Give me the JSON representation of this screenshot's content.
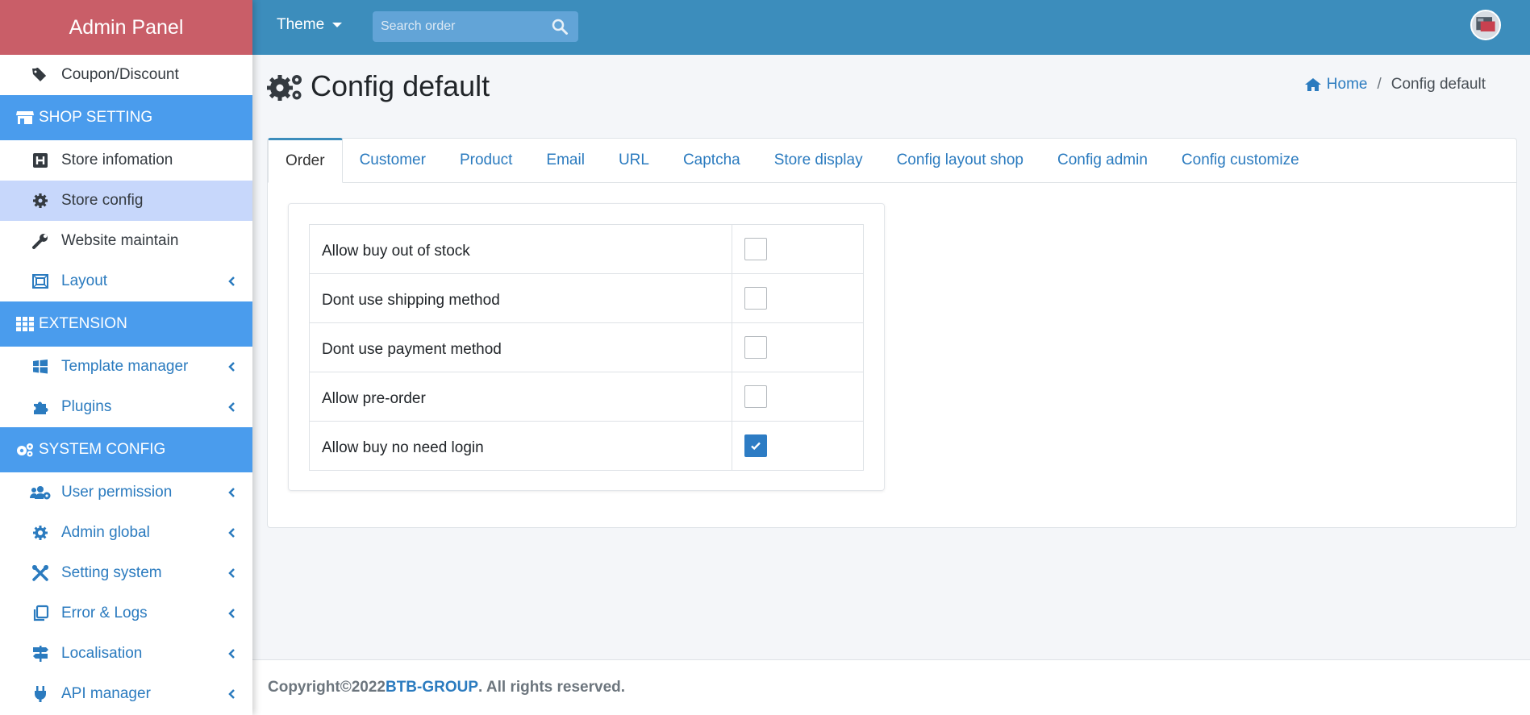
{
  "sidebar": {
    "brand": "Admin Panel",
    "items_top": [
      {
        "label": "Coupon/Discount",
        "icon": "tags-icon"
      }
    ],
    "shop_header": "SHOP SETTING",
    "shop_items": [
      {
        "label": "Store infomation",
        "icon": "h-square-icon"
      },
      {
        "label": "Store config",
        "icon": "gear-icon"
      },
      {
        "label": "Website maintain",
        "icon": "wrench-icon"
      },
      {
        "label": "Layout",
        "icon": "layout-icon"
      }
    ],
    "extension_header": "EXTENSION",
    "extension_items": [
      {
        "label": "Template manager",
        "icon": "windows-icon"
      },
      {
        "label": "Plugins",
        "icon": "puzzle-icon"
      }
    ],
    "system_header": "SYSTEM CONFIG",
    "system_items": [
      {
        "label": "User permission",
        "icon": "users-cog-icon"
      },
      {
        "label": "Admin global",
        "icon": "cog-badge-icon"
      },
      {
        "label": "Setting system",
        "icon": "tools-icon"
      },
      {
        "label": "Error & Logs",
        "icon": "copy-icon"
      },
      {
        "label": "Localisation",
        "icon": "signs-icon"
      },
      {
        "label": "API manager",
        "icon": "plug-icon"
      }
    ]
  },
  "topbar": {
    "theme_label": "Theme",
    "search_placeholder": "Search order"
  },
  "page": {
    "title": "Config default",
    "breadcrumb_home": "Home",
    "breadcrumb_current": "Config default"
  },
  "tabs": [
    "Order",
    "Customer",
    "Product",
    "Email",
    "URL",
    "Captcha",
    "Store display",
    "Config layout shop",
    "Config admin",
    "Config customize"
  ],
  "options": [
    {
      "label": "Allow buy out of stock",
      "checked": false
    },
    {
      "label": "Dont use shipping method",
      "checked": false
    },
    {
      "label": "Dont use payment method",
      "checked": false
    },
    {
      "label": "Allow pre-order",
      "checked": false
    },
    {
      "label": "Allow buy no need login",
      "checked": true
    }
  ],
  "footer": {
    "prefix": "Copyright©2022 ",
    "brand": "BTB-GROUP",
    "suffix": ". All rights reserved."
  },
  "colors": {
    "brand_bg": "#c95e68",
    "topbar_bg": "#3c8dbc",
    "section_header_bg": "#4a9ced",
    "active_item_bg": "#c7d7fb",
    "link_blue": "#2b7bbf"
  }
}
